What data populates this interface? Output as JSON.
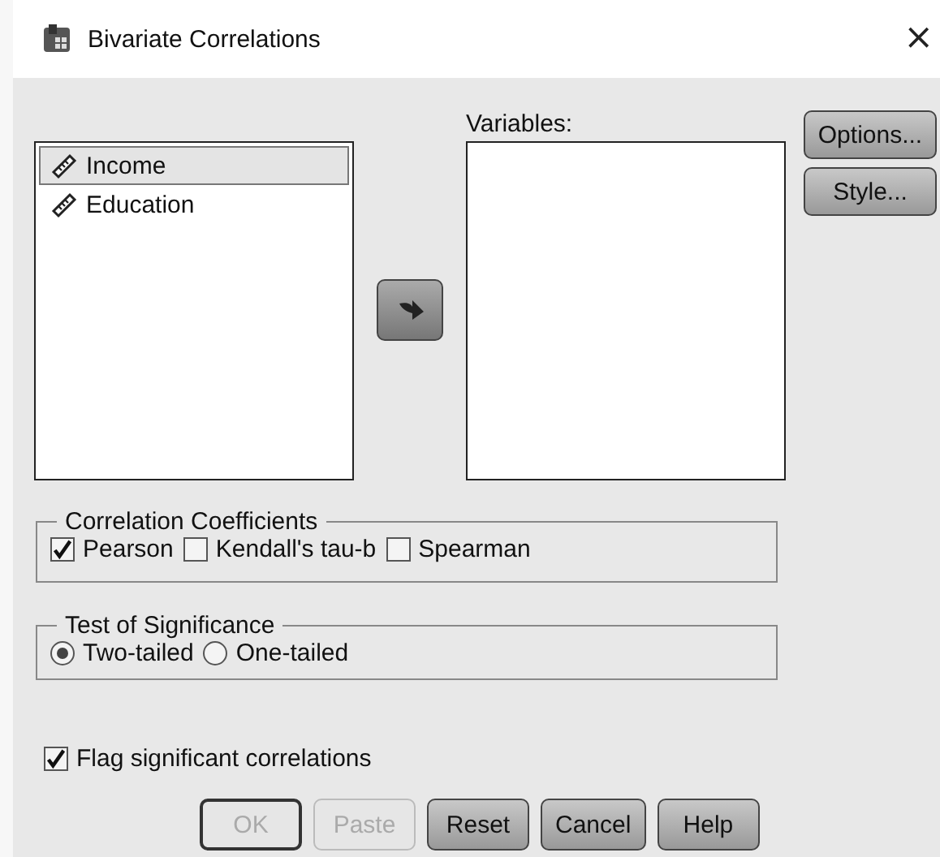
{
  "window": {
    "title": "Bivariate Correlations",
    "close": "×"
  },
  "source_list": {
    "items": [
      {
        "label": "Income",
        "selected": true
      },
      {
        "label": "Education",
        "selected": false
      }
    ]
  },
  "variables": {
    "label": "Variables:"
  },
  "side_buttons": [
    {
      "label": "Options..."
    },
    {
      "label": "Style..."
    }
  ],
  "correlation_coefficients": {
    "title": "Correlation Coefficients",
    "options": [
      {
        "label": "Pearson",
        "checked": true
      },
      {
        "label": "Kendall's tau-b",
        "checked": false
      },
      {
        "label": "Spearman",
        "checked": false
      }
    ]
  },
  "test_of_significance": {
    "title": "Test of Significance",
    "options": [
      {
        "label": "Two-tailed",
        "selected": true
      },
      {
        "label": "One-tailed",
        "selected": false
      }
    ]
  },
  "flag": {
    "label": "Flag significant correlations",
    "checked": true
  },
  "buttons": [
    {
      "label": "OK",
      "disabled": true,
      "default": true
    },
    {
      "label": "Paste",
      "disabled": true,
      "default": false
    },
    {
      "label": "Reset",
      "disabled": false,
      "default": false
    },
    {
      "label": "Cancel",
      "disabled": false,
      "default": false
    },
    {
      "label": "Help",
      "disabled": false,
      "default": false
    }
  ]
}
